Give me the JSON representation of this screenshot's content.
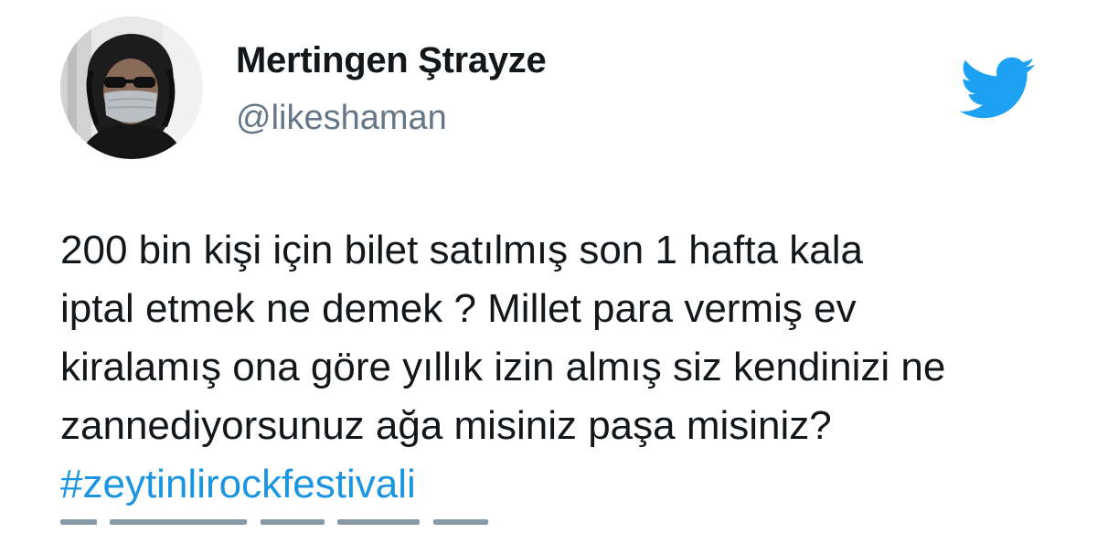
{
  "author": {
    "display_name": "Mertingen Ştrayze",
    "handle": "@likeshaman",
    "avatar_icon": "profile-photo-masked-man"
  },
  "brand": {
    "icon": "twitter-bird-icon",
    "color": "#1DA1F2"
  },
  "tweet": {
    "lines": [
      "200 bin kişi için bilet satılmış son 1 hafta kala",
      "iptal etmek ne demek ? Millet para vermiş ev",
      "kiralamış ona göre yıllık izin almış siz kendinizi ne",
      "zannediyorsunuz ağa misiniz paşa misiniz?"
    ],
    "hashtag": "#zeytinlirockfestivali"
  },
  "colors": {
    "text": "#14171A",
    "secondary_text": "#657786",
    "link": "#1B95E0"
  }
}
